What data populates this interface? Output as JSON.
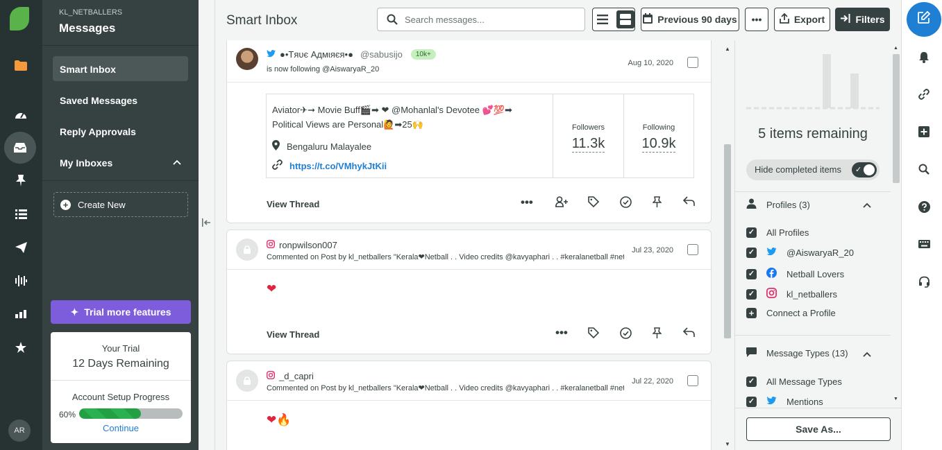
{
  "rail": {
    "icons": [
      "folder-icon",
      "speedometer-icon",
      "inbox-icon",
      "pin-icon",
      "list-icon",
      "send-icon",
      "audio-wave-icon",
      "bar-chart-icon",
      "star-icon"
    ],
    "avatar_initials": "AR"
  },
  "nav": {
    "account": "KL_NETBALLERS",
    "title": "Messages",
    "items": [
      {
        "label": "Smart Inbox",
        "active": true
      },
      {
        "label": "Saved Messages"
      },
      {
        "label": "Reply Approvals"
      },
      {
        "label": "My Inboxes"
      }
    ],
    "create_new": "Create New",
    "trial_button": "Trial more features",
    "trial": {
      "heading": "Your Trial",
      "remaining": "12 Days Remaining",
      "setup_label": "Account Setup Progress",
      "progress_text": "60%",
      "progress_value": 0.6,
      "continue": "Continue"
    }
  },
  "topbar": {
    "title": "Smart Inbox",
    "search_placeholder": "Search messages...",
    "date_range": "Previous 90 days",
    "more": "•••",
    "export": "Export",
    "filters": "Filters"
  },
  "messages": [
    {
      "network": "twitter",
      "name": "●•Tяυє Aдмιяєя•●",
      "handle": "@sabusijo",
      "badge": "10k+",
      "subline": "is now following @AiswaryaR_20",
      "date": "Aug 10, 2020",
      "bio_line1": "Aviator✈➞ Movie Buff🎬➡ ❤ @Mohanlal's Devotee 💕💯➡",
      "bio_line2": "Political Views are Personal🙋➡25🙌",
      "location": "Bengaluru Malayalee",
      "link": "https://t.co/VMhykJtKii",
      "followers_label": "Followers",
      "followers": "11.3k",
      "following_label": "Following",
      "following": "10.9k",
      "view_thread": "View Thread"
    },
    {
      "network": "instagram",
      "name": "ronpwilson007",
      "subline": "Commented on Post by kl_netballers \"Kerala❤Netball . . Video credits @kavyaphari . . #keralanetball #netball #keralanetballlovers",
      "date": "Jul 23, 2020",
      "body": "❤",
      "view_thread": "View Thread"
    },
    {
      "network": "instagram",
      "name": "_d_capri",
      "subline": "Commented on Post by kl_netballers \"Kerala❤Netball . . Video credits @kavyaphari . . #keralanetball #netball #keralanetballlovers",
      "date": "Jul 22, 2020",
      "body": "❤🔥"
    }
  ],
  "side": {
    "remaining": "5 items remaining",
    "hide_completed": "Hide completed items",
    "profiles_heading": "Profiles (3)",
    "profiles": [
      {
        "label": "All Profiles",
        "icon": "none"
      },
      {
        "label": "@AiswaryaR_20",
        "icon": "twitter-icon"
      },
      {
        "label": "Netball Lovers",
        "icon": "facebook-icon"
      },
      {
        "label": "kl_netballers",
        "icon": "instagram-icon"
      }
    ],
    "connect_profile": "Connect a Profile",
    "types_heading": "Message Types (13)",
    "types": [
      {
        "label": "All Message Types"
      },
      {
        "label": "Mentions"
      }
    ],
    "save_as": "Save As..."
  },
  "colors": {
    "accent_blue": "#1f7fd3",
    "trial_purple": "#7d5ddb",
    "progress_green": "#23a043",
    "brand_green": "#59b34a"
  }
}
